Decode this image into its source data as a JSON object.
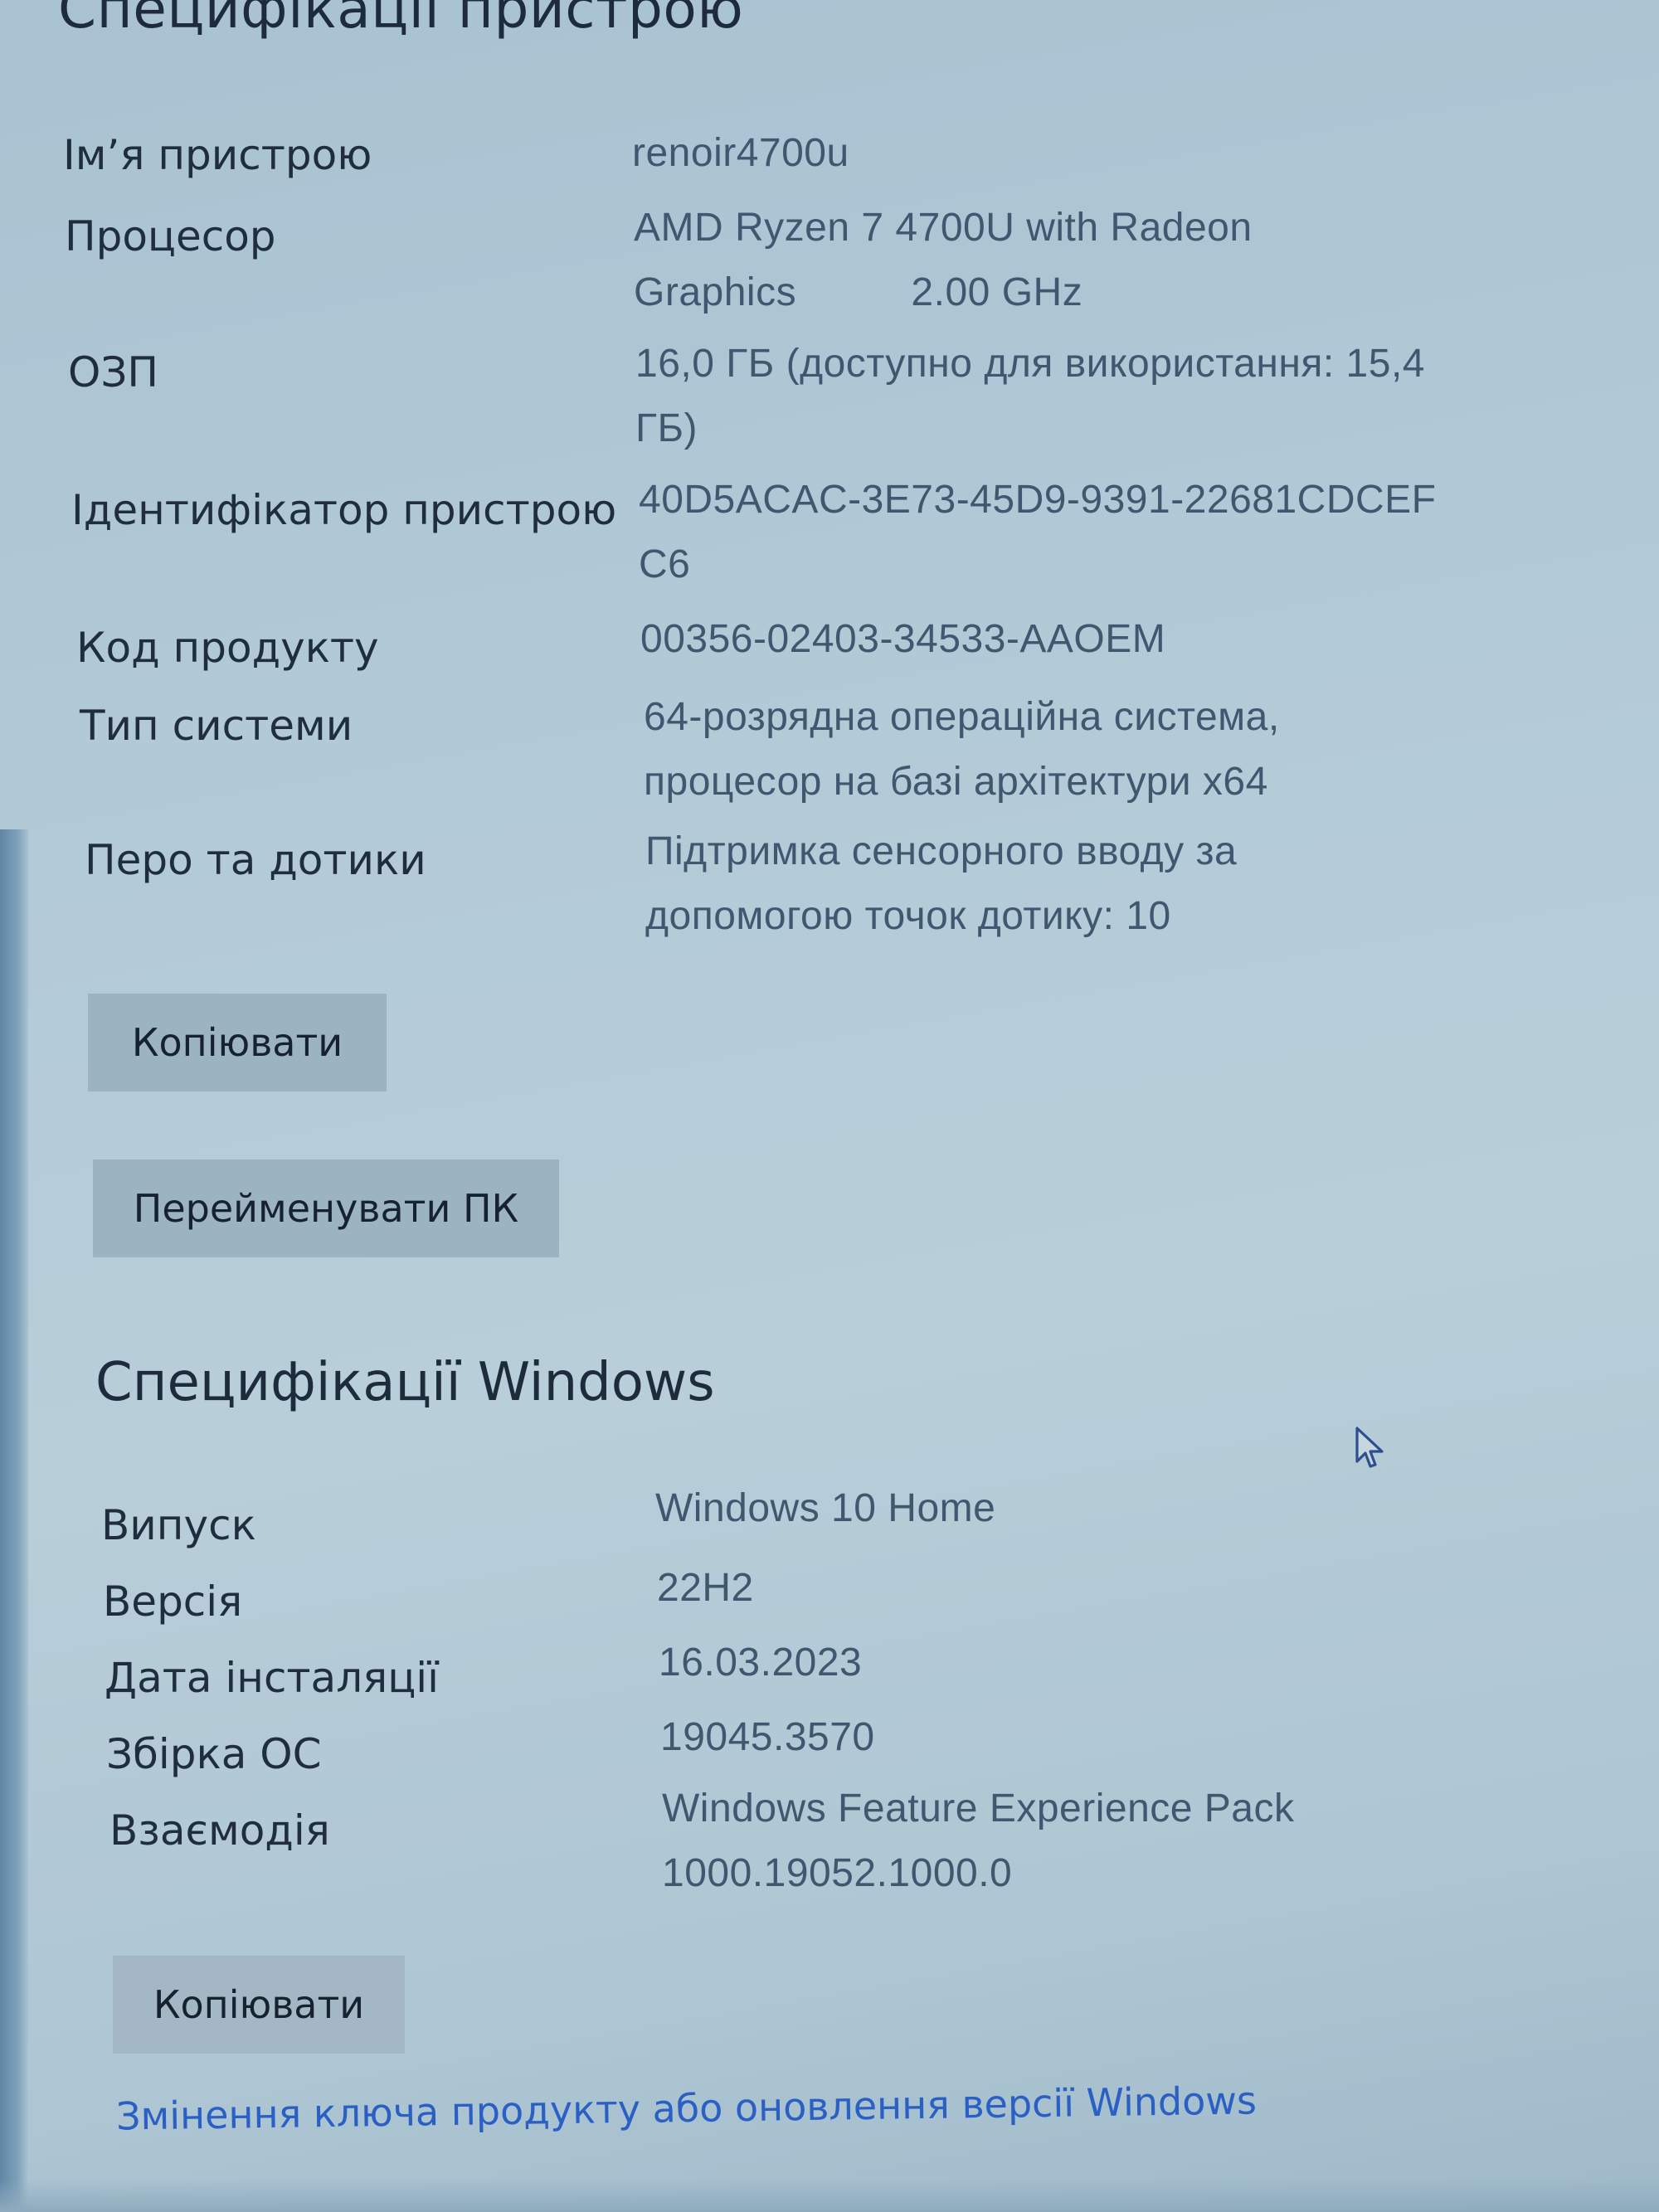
{
  "device_specs": {
    "title": "Специфікації пристрою",
    "rows": [
      {
        "label": "Ім’я пристрою",
        "value": "renoir4700u"
      },
      {
        "label": "Процесор",
        "value": "AMD Ryzen 7 4700U with Radeon\nGraphics          2.00 GHz"
      },
      {
        "label": "ОЗП",
        "value": "16,0 ГБ (доступно для використання: 15,4\nГБ)"
      },
      {
        "label": "Ідентифікатор пристрою",
        "value": "40D5ACAC-3E73-45D9-9391-22681CDCEF\nC6"
      },
      {
        "label": "Код продукту",
        "value": "00356-02403-34533-AAOEM"
      },
      {
        "label": "Тип системи",
        "value": "64-розрядна операційна система,\nпроцесор на базі архітектури x64"
      },
      {
        "label": "Перо та дотики",
        "value": "Підтримка сенсорного вводу за\nдопомогою точок дотику: 10"
      }
    ],
    "copy_button": "Копіювати",
    "rename_button": "Перейменувати ПК"
  },
  "windows_specs": {
    "title": "Специфікації Windows",
    "rows": [
      {
        "label": "Випуск",
        "value": "Windows 10 Home"
      },
      {
        "label": "Версія",
        "value": "22H2"
      },
      {
        "label": "Дата інсталяції",
        "value": "16.03.2023"
      },
      {
        "label": "Збірка ОС",
        "value": "19045.3570"
      },
      {
        "label": "Взаємодія",
        "value": "Windows Feature Experience Pack\n1000.19052.1000.0"
      }
    ],
    "copy_button": "Копіювати",
    "change_key_link": "Змінення ключа продукту або оновлення версії Windows"
  },
  "icons": {
    "cursor": "mouse-pointer-icon"
  },
  "colors": {
    "link": "#2a5fc4",
    "button_bg": "#9cb3c1",
    "background": "#b3cad7"
  }
}
